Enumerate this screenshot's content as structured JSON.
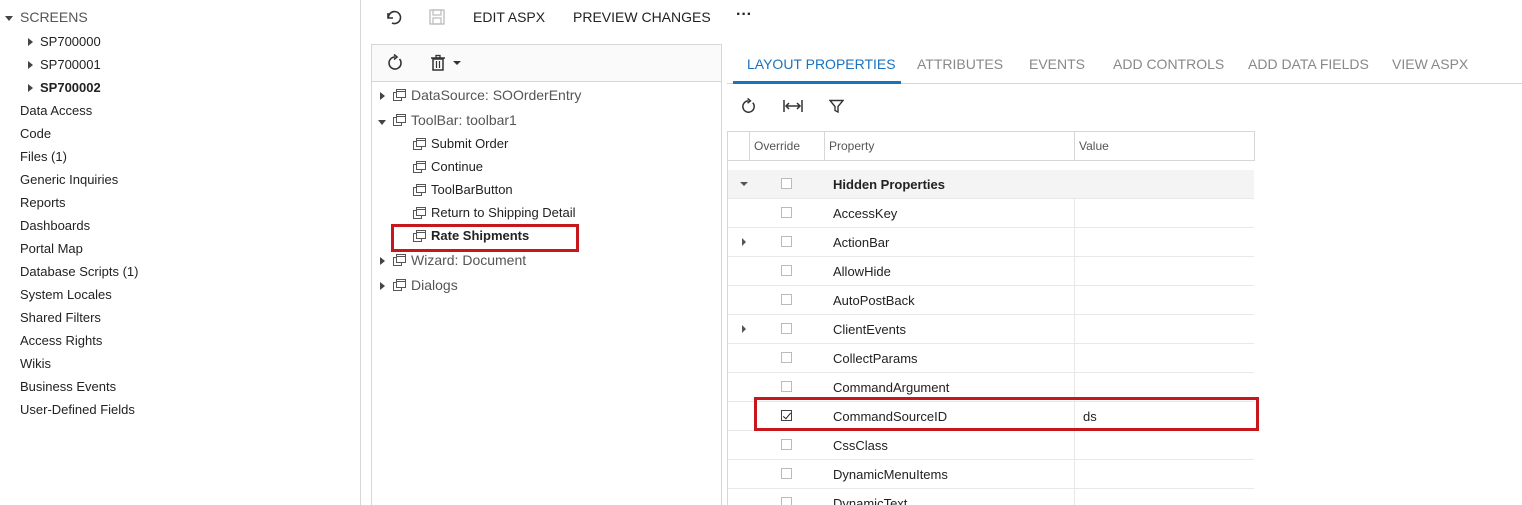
{
  "nav": {
    "screens_label": "SCREENS",
    "screens": [
      {
        "label": "SP700000"
      },
      {
        "label": "SP700001"
      },
      {
        "label": "SP700002"
      }
    ],
    "items": [
      "Data Access",
      "Code",
      "Files (1)",
      "Generic Inquiries",
      "Reports",
      "Dashboards",
      "Portal Map",
      "Database Scripts (1)",
      "System Locales",
      "Shared Filters",
      "Access Rights",
      "Wikis",
      "Business Events",
      "User-Defined Fields"
    ]
  },
  "toolbar": {
    "undo_icon": "undo-icon",
    "save_icon": "save-icon",
    "edit_aspx": "EDIT ASPX",
    "preview_changes": "PREVIEW CHANGES",
    "more": "···"
  },
  "tree": {
    "nodes": [
      {
        "label": "DataSource: SOOrderEntry"
      },
      {
        "label": "ToolBar: toolbar1"
      },
      {
        "label": "Submit Order"
      },
      {
        "label": "Continue"
      },
      {
        "label": "ToolBarButton"
      },
      {
        "label": "Return to Shipping Detail"
      },
      {
        "label": "Rate Shipments"
      },
      {
        "label": "Wizard: Document"
      },
      {
        "label": "Dialogs"
      }
    ]
  },
  "tabs": [
    "LAYOUT PROPERTIES",
    "ATTRIBUTES",
    "EVENTS",
    "ADD CONTROLS",
    "ADD DATA FIELDS",
    "VIEW ASPX"
  ],
  "grid": {
    "headers": {
      "override": "Override",
      "property": "Property",
      "value": "Value"
    },
    "rows": [
      {
        "property": "Hidden Properties",
        "value": "",
        "checked": false
      },
      {
        "property": "AccessKey",
        "value": "",
        "checked": false
      },
      {
        "property": "ActionBar",
        "value": "",
        "checked": false
      },
      {
        "property": "AllowHide",
        "value": "",
        "checked": false
      },
      {
        "property": "AutoPostBack",
        "value": "",
        "checked": false
      },
      {
        "property": "ClientEvents",
        "value": "",
        "checked": false
      },
      {
        "property": "CollectParams",
        "value": "",
        "checked": false
      },
      {
        "property": "CommandArgument",
        "value": "",
        "checked": false
      },
      {
        "property": "CommandSourceID",
        "value": "ds",
        "checked": true
      },
      {
        "property": "CssClass",
        "value": "",
        "checked": false
      },
      {
        "property": "DynamicMenuItems",
        "value": "",
        "checked": false
      },
      {
        "property": "DynamicText",
        "value": "",
        "checked": false
      }
    ]
  },
  "colors": {
    "accent": "#1a73c1",
    "highlight": "#c8161d"
  }
}
